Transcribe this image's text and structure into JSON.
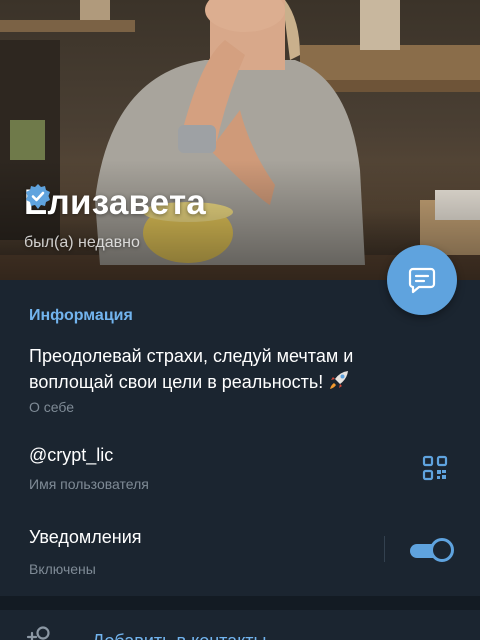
{
  "profile": {
    "name": "Елизавета",
    "status": "был(а) недавно"
  },
  "info": {
    "section_title": "Информация",
    "bio": "Преодолевай страхи, следуй мечтам и воплощай свои цели в реальность!",
    "bio_label": "О себе",
    "username": "@crypt_lic",
    "username_label": "Имя пользователя",
    "notifications": "Уведомления",
    "notifications_state": "Включены",
    "notifications_enabled": true
  },
  "actions": {
    "add_contact": "Добавить в контакты"
  },
  "icons": {
    "verified": "verified-badge-icon",
    "message": "message-icon",
    "qr": "qr-code-icon",
    "add_contact": "add-contact-icon",
    "rocket": "rocket-emoji"
  },
  "colors": {
    "accent": "#5fa3de",
    "accent_text": "#72b4ee",
    "background": "#1b2530",
    "secondary_text": "#7f8b96"
  }
}
